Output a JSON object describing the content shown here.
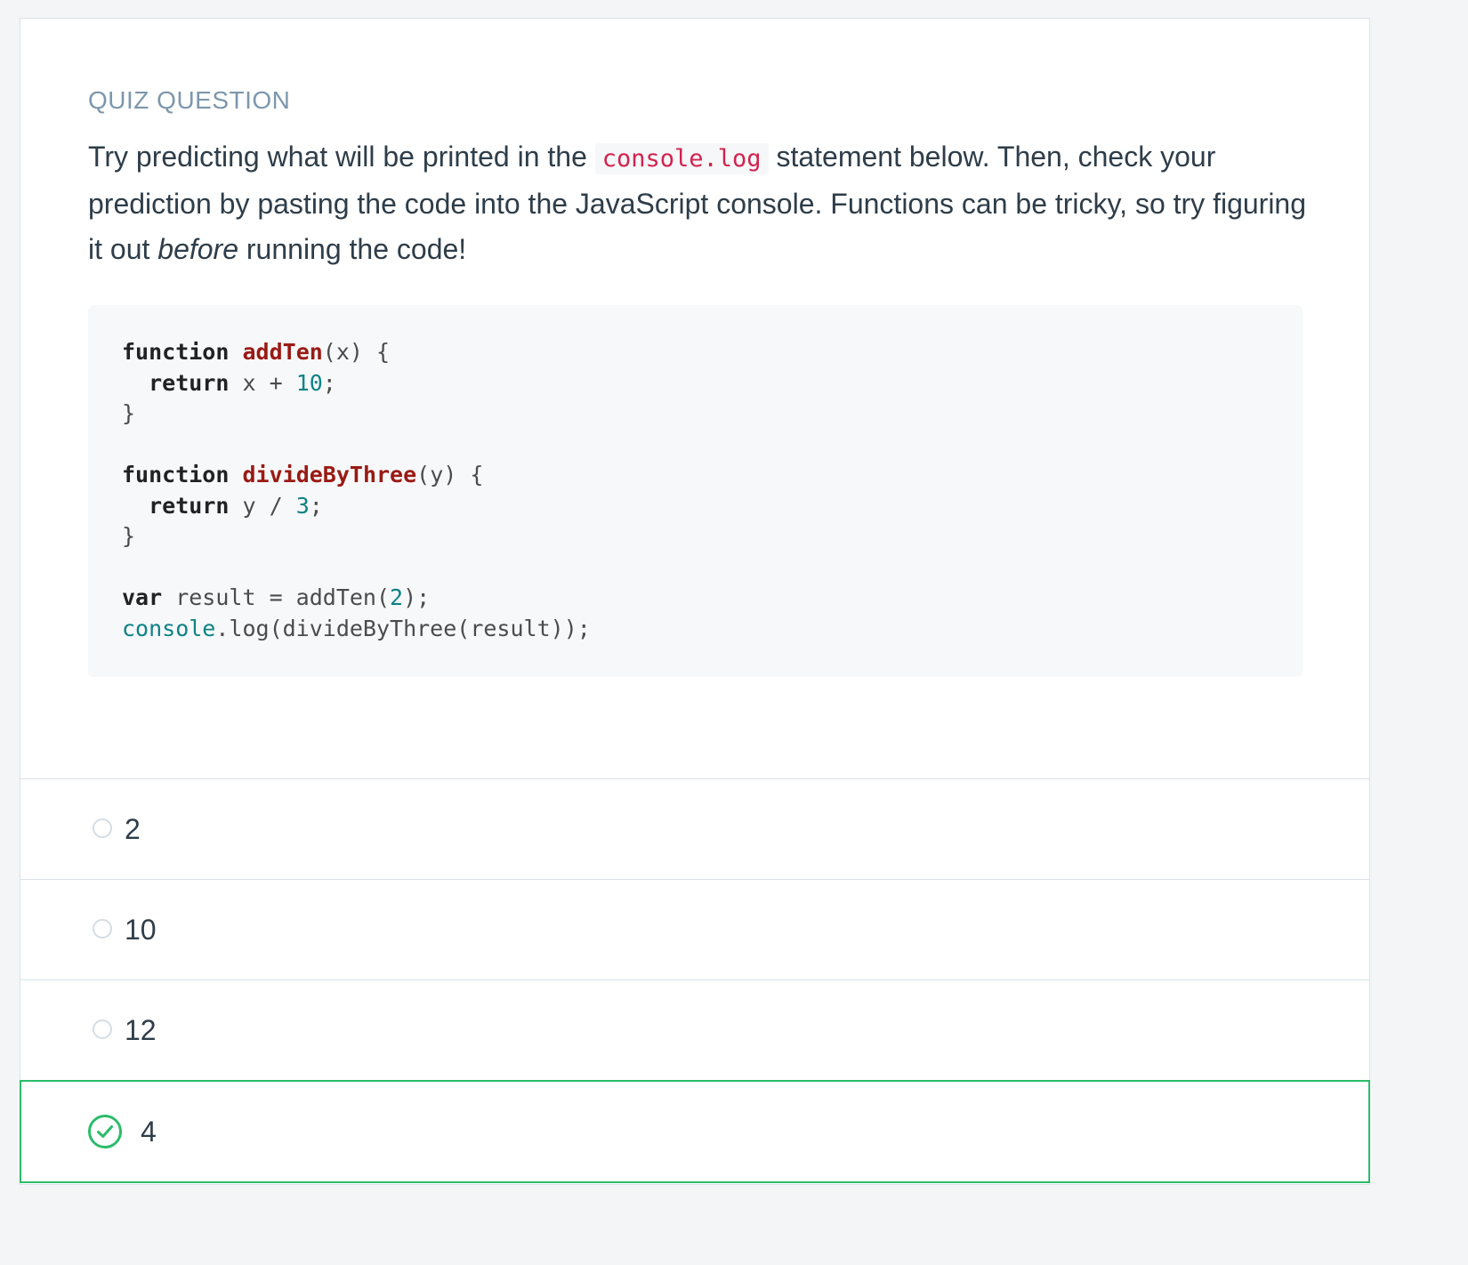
{
  "quiz": {
    "label": "QUIZ QUESTION",
    "question": {
      "part1": "Try predicting what will be printed in the ",
      "inline_code": "console.log",
      "part2": " statement below. Then, check your prediction by pasting the code into the JavaScript console. Functions can be tricky, so try figuring it out ",
      "emphasis": "before",
      "part3": " running the code!"
    },
    "code": {
      "l1_kw": "function",
      "l1_fn": "addTen",
      "l1_rest": "(x) {",
      "l2_indent": "  ",
      "l2_kw": "return",
      "l2_mid": " x + ",
      "l2_num": "10",
      "l2_end": ";",
      "l3": "}",
      "l5_kw": "function",
      "l5_fn": "divideByThree",
      "l5_rest": "(y) {",
      "l6_indent": "  ",
      "l6_kw": "return",
      "l6_mid": " y / ",
      "l6_num": "3",
      "l6_end": ";",
      "l7": "}",
      "l9_kw": "var",
      "l9_mid": " result = addTen(",
      "l9_num": "2",
      "l9_end": ");",
      "l10_builtin": "console",
      "l10_rest": ".log(divideByThree(result));"
    },
    "options": [
      {
        "label": "2",
        "selected": false
      },
      {
        "label": "10",
        "selected": false
      },
      {
        "label": "12",
        "selected": false
      },
      {
        "label": "4",
        "selected": true
      }
    ],
    "colors": {
      "accent_selected": "#2bbc6a",
      "label": "#7d97ad",
      "text": "#2e3d49",
      "inline_code": "#d2224e"
    }
  }
}
